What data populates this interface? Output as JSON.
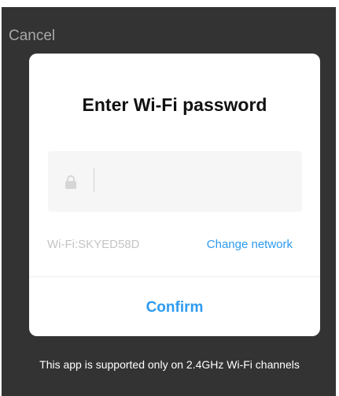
{
  "colors": {
    "backdrop": "#333333",
    "dialog_bg": "#ffffff",
    "accent": "#2d9bf0",
    "muted_text": "#c4c4c4",
    "field_bg": "#f6f6f6"
  },
  "top_bar": {
    "cancel_label": "Cancel"
  },
  "dialog": {
    "title": "Enter Wi-Fi password",
    "password_field": {
      "icon": "lock-icon",
      "value": "",
      "placeholder": ""
    },
    "ssid_text": "Wi-Fi:SKYED58D",
    "change_network_label": "Change network",
    "confirm_label": "Confirm"
  },
  "footer": {
    "note": "This app is supported only on 2.4GHz Wi-Fi channels"
  }
}
